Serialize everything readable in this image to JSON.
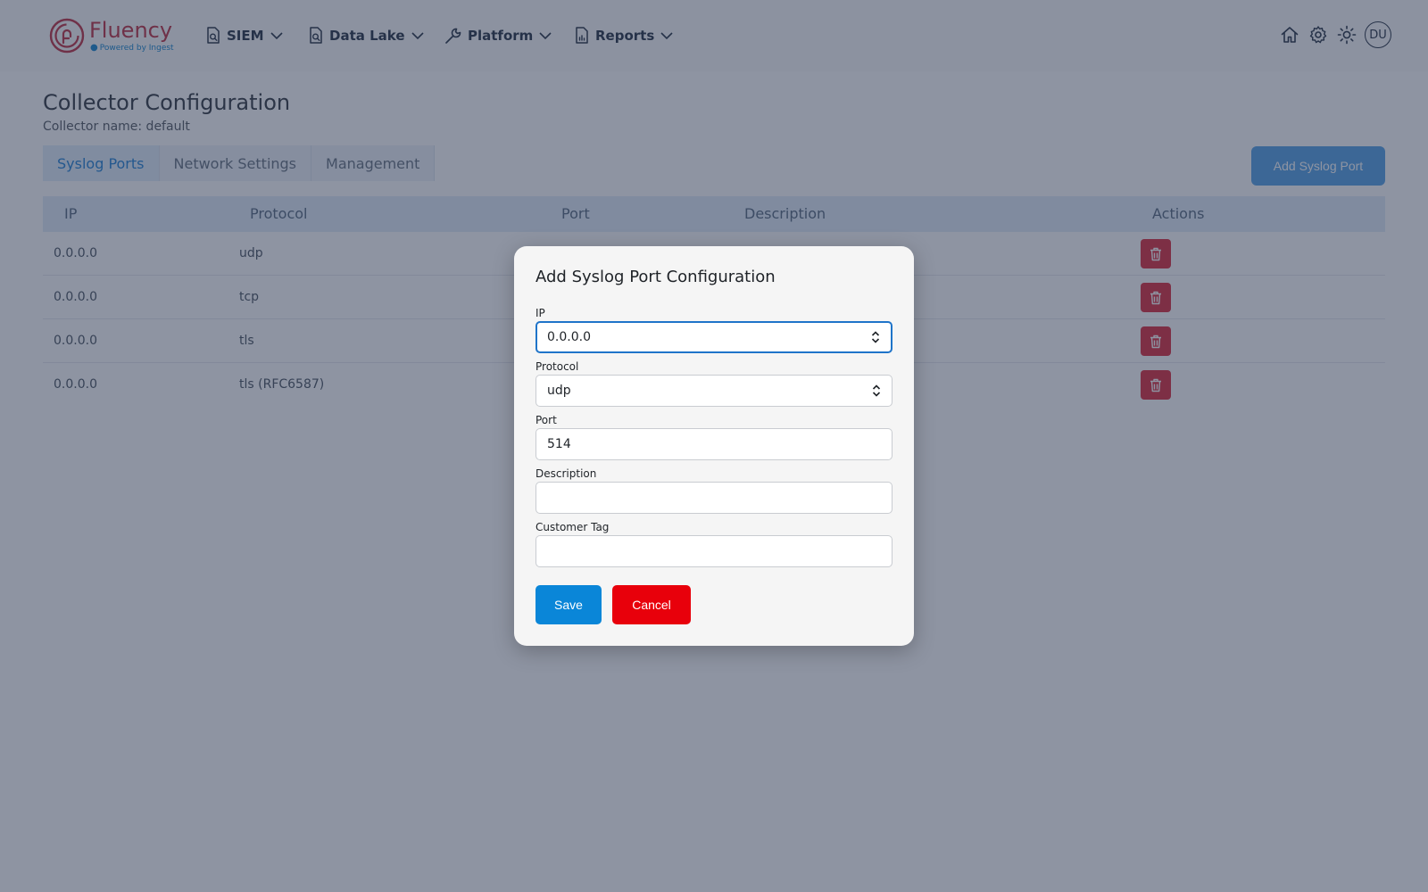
{
  "brand": {
    "name": "Fluency",
    "tagline": "Powered by Ingest"
  },
  "nav": {
    "items": [
      {
        "label": "SIEM",
        "icon": "search-document-icon"
      },
      {
        "label": "Data Lake",
        "icon": "search-document-icon"
      },
      {
        "label": "Platform",
        "icon": "wrench-icon"
      },
      {
        "label": "Reports",
        "icon": "chart-document-icon"
      }
    ],
    "right_icons": [
      "home-icon",
      "gear-icon",
      "sun-icon"
    ],
    "avatar_initials": "DU"
  },
  "page": {
    "title": "Collector Configuration",
    "subtitle": "Collector name: default",
    "tabs": [
      {
        "label": "Syslog Ports",
        "active": true
      },
      {
        "label": "Network Settings",
        "active": false
      },
      {
        "label": "Management",
        "active": false
      }
    ],
    "add_button_label": "Add Syslog Port"
  },
  "table": {
    "headers": {
      "ip": "IP",
      "protocol": "Protocol",
      "port": "Port",
      "description": "Description",
      "actions": "Actions"
    },
    "rows": [
      {
        "ip": "0.0.0.0",
        "protocol": "udp"
      },
      {
        "ip": "0.0.0.0",
        "protocol": "tcp"
      },
      {
        "ip": "0.0.0.0",
        "protocol": "tls"
      },
      {
        "ip": "0.0.0.0",
        "protocol": "tls (RFC6587)"
      }
    ]
  },
  "modal": {
    "title": "Add Syslog Port Configuration",
    "fields": {
      "ip": {
        "label": "IP",
        "value": "0.0.0.0"
      },
      "protocol": {
        "label": "Protocol",
        "value": "udp"
      },
      "port": {
        "label": "Port",
        "value": "514"
      },
      "description": {
        "label": "Description",
        "value": ""
      },
      "customer_tag": {
        "label": "Customer Tag",
        "value": ""
      }
    },
    "save_label": "Save",
    "cancel_label": "Cancel"
  },
  "colors": {
    "brand_red": "#c0394b",
    "primary_blue": "#0a86d8",
    "danger_red": "#e8000b"
  }
}
